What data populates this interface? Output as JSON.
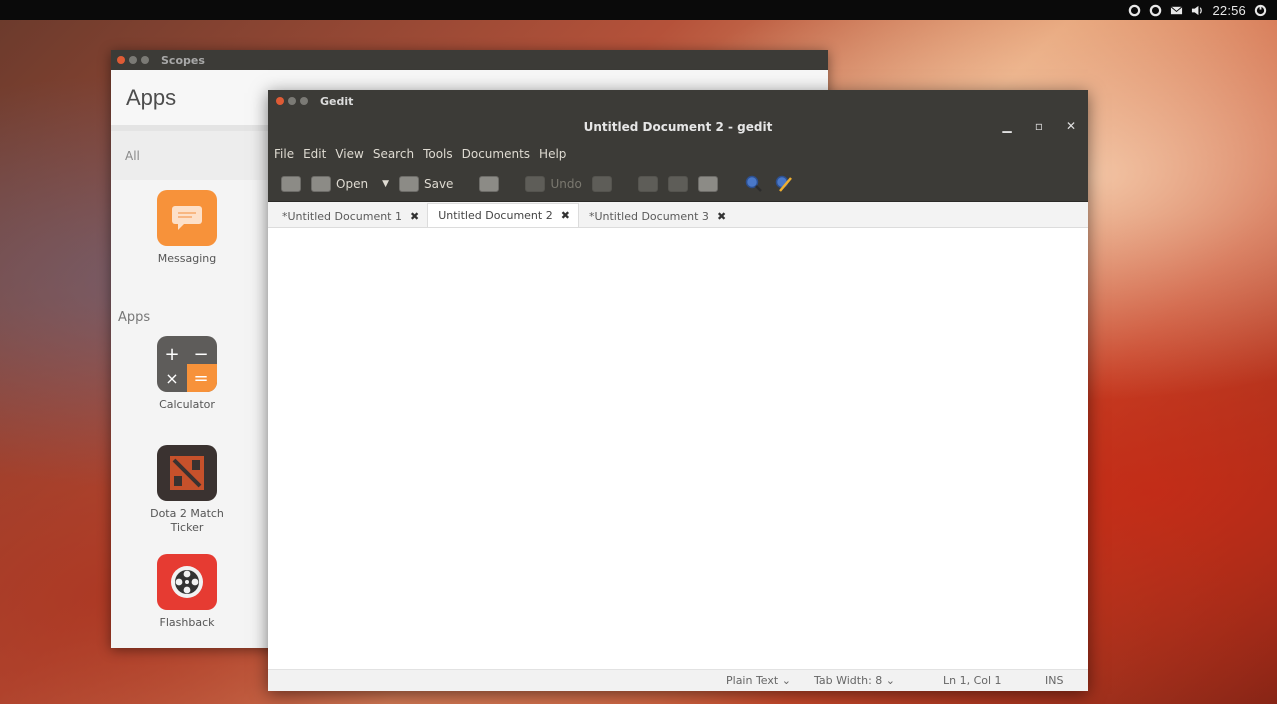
{
  "panel": {
    "clock": "22:56",
    "icons": [
      "network-icon",
      "settings-icon",
      "mail-icon",
      "volume-icon",
      "power-icon"
    ]
  },
  "scopes": {
    "window_title": "Scopes",
    "header": "Apps",
    "filter": "All",
    "featured_app": {
      "label": "Messaging",
      "icon": "messaging-icon",
      "color": "#f7923a"
    },
    "section_label": "Apps",
    "apps": [
      {
        "label": "Calculator",
        "icon": "calculator-icon"
      },
      {
        "label": "Dota 2 Match Ticker",
        "icon": "dota-icon"
      },
      {
        "label": "Flashback",
        "icon": "film-reel-icon"
      }
    ]
  },
  "gedit": {
    "window_title": "Gedit",
    "document_title": "Untitled Document 2 - gedit",
    "menu": [
      "File",
      "Edit",
      "View",
      "Search",
      "Tools",
      "Documents",
      "Help"
    ],
    "toolbar": {
      "open_label": "Open",
      "save_label": "Save",
      "undo_label": "Undo"
    },
    "tabs": [
      {
        "label": "*Untitled Document 1",
        "active": false
      },
      {
        "label": "Untitled Document 2",
        "active": true
      },
      {
        "label": "*Untitled Document 3",
        "active": false
      }
    ],
    "status": {
      "language": "Plain Text",
      "tab_width": "Tab Width: 8",
      "position": "Ln 1, Col 1",
      "mode": "INS"
    }
  }
}
